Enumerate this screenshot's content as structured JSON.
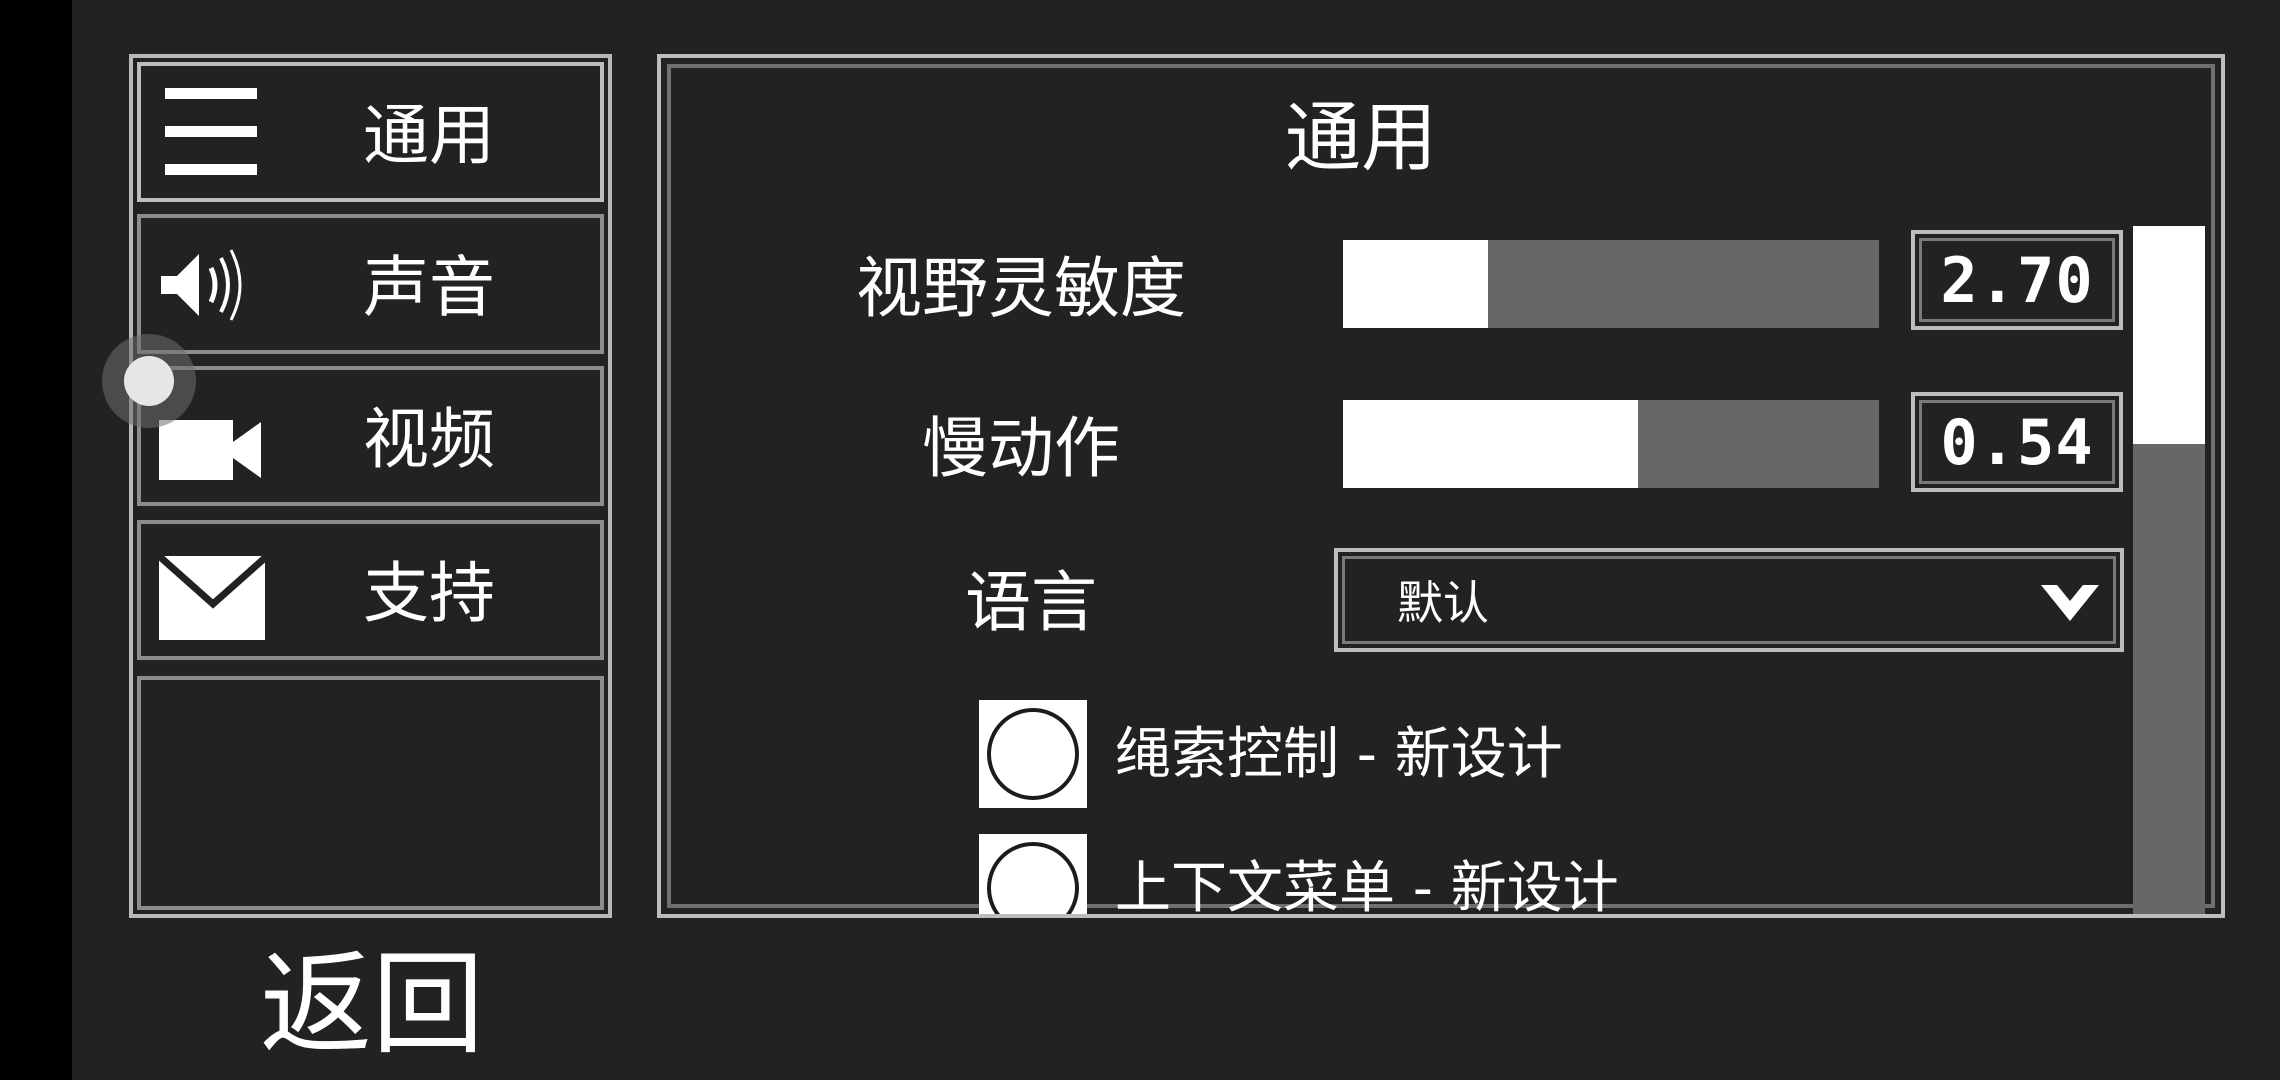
{
  "sidebar": {
    "items": [
      {
        "label": "通用",
        "icon": "menu-icon"
      },
      {
        "label": "声音",
        "icon": "speaker-icon"
      },
      {
        "label": "视频",
        "icon": "video-camera-icon"
      },
      {
        "label": "支持",
        "icon": "envelope-icon"
      }
    ],
    "active_index": 0
  },
  "back_label": "返回",
  "panel": {
    "title": "通用",
    "rows": [
      {
        "label": "视野灵敏度",
        "value": "2.70",
        "fill_fraction": 0.27
      },
      {
        "label": "慢动作",
        "value": "0.54",
        "fill_fraction": 0.55
      }
    ],
    "language": {
      "label": "语言",
      "selected": "默认",
      "icon": "chevron-down-icon"
    },
    "checkboxes": [
      {
        "label": "绳索控制 - 新设计",
        "checked": false
      },
      {
        "label": "上下文菜单 - 新设计",
        "checked": false
      }
    ],
    "scroll_fraction": 0.0
  },
  "colors": {
    "background": "#222222",
    "border": "#bdbdbd",
    "track": "#676767",
    "fill": "#ffffff"
  }
}
